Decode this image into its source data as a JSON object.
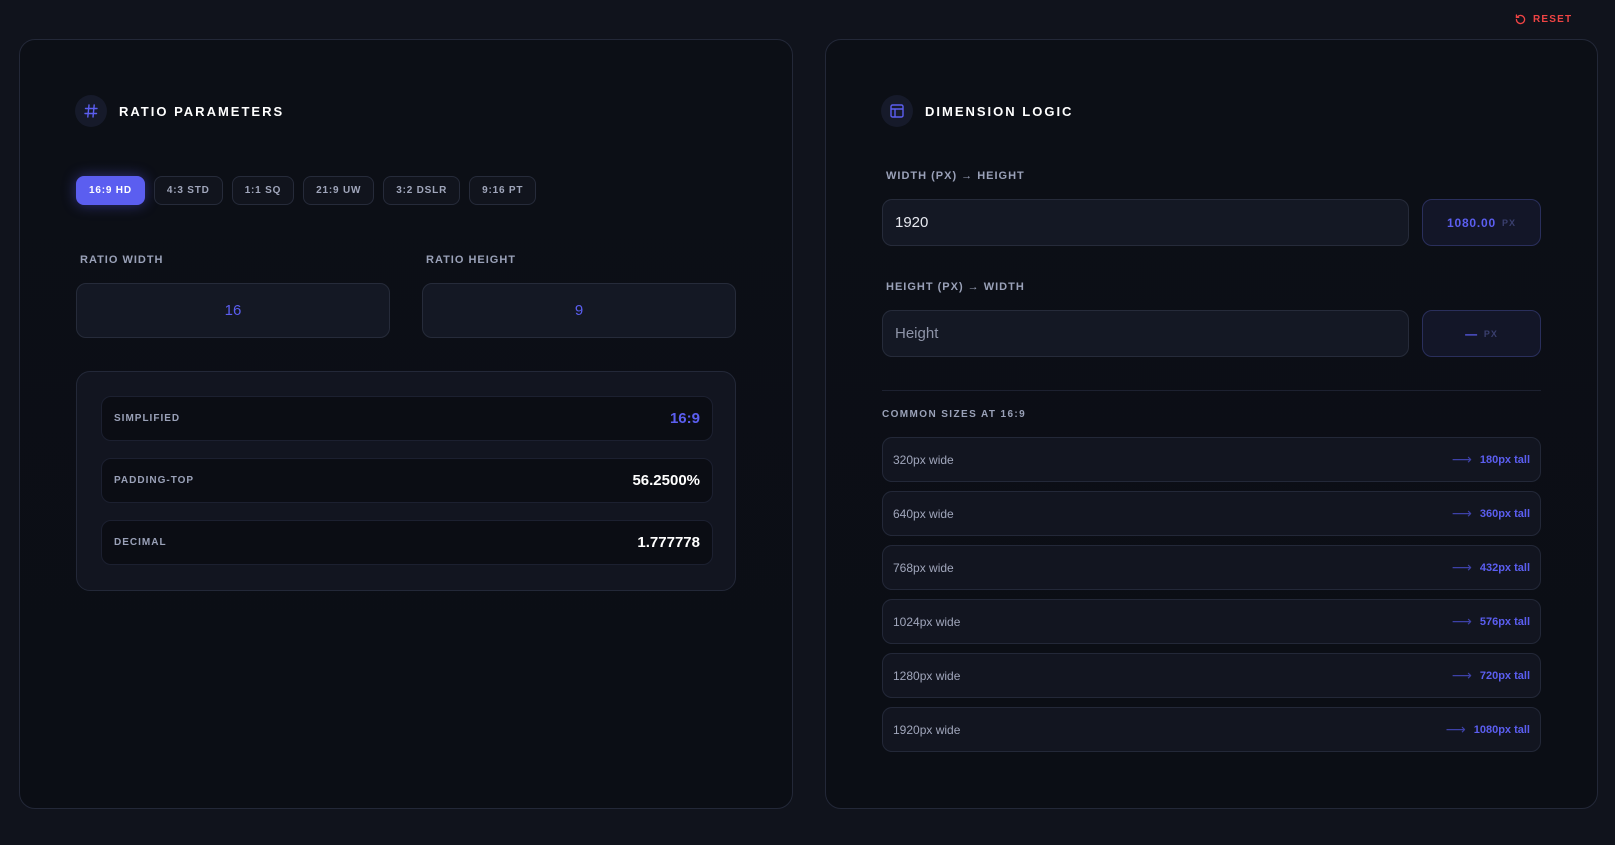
{
  "toolbar": {
    "reset_label": "RESET"
  },
  "left": {
    "title": "RATIO PARAMETERS",
    "presets": [
      "16:9 HD",
      "4:3 STD",
      "1:1 SQ",
      "21:9 UW",
      "3:2 DSLR",
      "9:16 PT"
    ],
    "active_preset": "16:9 HD",
    "ratio_width_label": "RATIO WIDTH",
    "ratio_height_label": "RATIO HEIGHT",
    "ratio_width_value": "16",
    "ratio_height_value": "9",
    "results": [
      {
        "label": "SIMPLIFIED",
        "value": "16:9"
      },
      {
        "label": "PADDING-TOP",
        "value": "56.2500%"
      },
      {
        "label": "DECIMAL",
        "value": "1.777778"
      }
    ]
  },
  "right": {
    "title": "DIMENSION LOGIC",
    "width_label": "WIDTH (PX) → HEIGHT",
    "width_value": "1920",
    "width_result": "1080.00",
    "height_label": "HEIGHT (PX) → WIDTH",
    "height_placeholder": "Height",
    "height_result": "—",
    "unit": "PX",
    "sizes_label": "COMMON SIZES AT 16:9",
    "sizes": [
      {
        "wide": "320px wide",
        "tall": "180px tall"
      },
      {
        "wide": "640px wide",
        "tall": "360px tall"
      },
      {
        "wide": "768px wide",
        "tall": "432px tall"
      },
      {
        "wide": "1024px wide",
        "tall": "576px tall"
      },
      {
        "wide": "1280px wide",
        "tall": "720px tall"
      },
      {
        "wide": "1920px wide",
        "tall": "1080px tall"
      }
    ]
  },
  "colors": {
    "accent": "#5b5ef0",
    "danger": "#ef4444",
    "background": "#10131c"
  }
}
